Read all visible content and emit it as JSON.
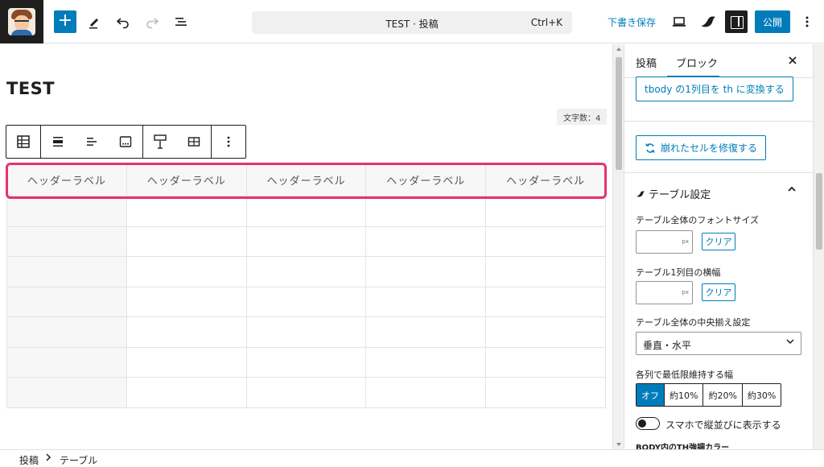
{
  "topbar": {
    "document_title": "TEST · 投稿",
    "shortcut": "Ctrl+K",
    "draft_label": "下書き保存",
    "publish_label": "公開"
  },
  "editor": {
    "post_title": "TEST",
    "char_count": "文字数：4",
    "table": {
      "headers": [
        "ヘッダーラベル",
        "ヘッダーラベル",
        "ヘッダーラベル",
        "ヘッダーラベル",
        "ヘッダーラベル"
      ],
      "body_rows": 7
    },
    "highlight_color": "#e5336e"
  },
  "sidebar": {
    "tab_post": "投稿",
    "tab_block": "ブロック",
    "convert_button": "tbody の1列目を th に変換する",
    "fix_button": "崩れたセルを修復する",
    "panel_title": "テーブル設定",
    "font_size_label": "テーブル全体のフォントサイズ",
    "font_size_unit": "px",
    "first_col_label": "テーブル1列目の横幅",
    "first_col_unit": "px",
    "clear_label": "クリア",
    "align_label": "テーブル全体の中央揃え設定",
    "align_value": "垂直・水平",
    "min_width_label": "各列で最低限維持する幅",
    "min_width_options": [
      "オフ",
      "約10%",
      "約20%",
      "約30%"
    ],
    "min_width_selected": "オフ",
    "mobile_toggle_label": "スマホで縦並びに表示する",
    "th_color_label": "BODY内のTH強調カラー"
  },
  "footer": {
    "breadcrumb": [
      "投稿",
      "テーブル"
    ]
  },
  "colors": {
    "accent": "#007cba",
    "dark": "#1e1e1e"
  }
}
